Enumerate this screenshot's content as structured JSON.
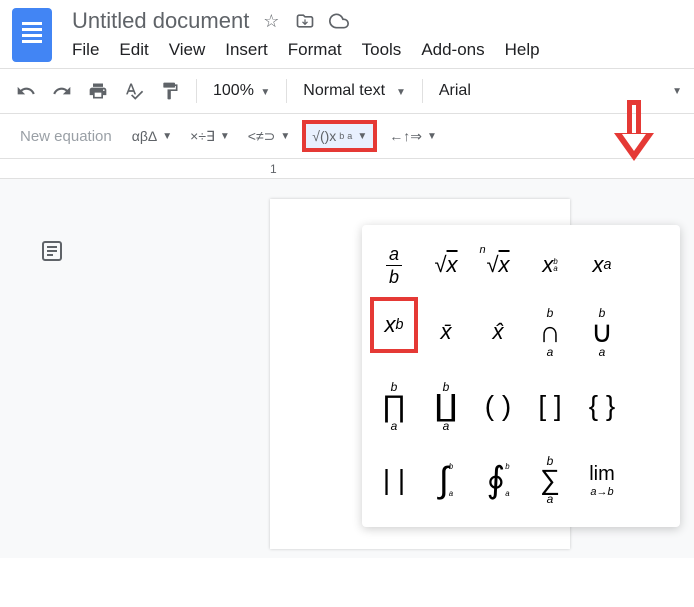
{
  "doc": {
    "title": "Untitled document"
  },
  "menu": {
    "file": "File",
    "edit": "Edit",
    "view": "View",
    "insert": "Insert",
    "format": "Format",
    "tools": "Tools",
    "addons": "Add-ons",
    "help": "Help"
  },
  "toolbar": {
    "zoom": "100%",
    "style": "Normal text",
    "font": "Arial"
  },
  "equation": {
    "new_label": "New equation",
    "greek": "αβΔ",
    "ops": "×÷∃",
    "rels": "<≠⊃",
    "math": "√()x",
    "arrows": "←↑⇒"
  },
  "ruler": {
    "mark": "1"
  },
  "submenu": {
    "frac_a": "a",
    "frac_b": "b",
    "sqrt": "√x",
    "nroot_n": "n",
    "nroot_x": "√x",
    "xab_base": "x",
    "xab_a": "a",
    "xab_b": "b",
    "xsub_base": "x",
    "xsub_a": "a",
    "xsup_base": "x",
    "xsup_b": "b",
    "xbar": "x̄",
    "xhat": "x̂",
    "cap": "∩",
    "cap_a": "a",
    "cap_b": "b",
    "cup": "∪",
    "cup_a": "a",
    "cup_b": "b",
    "prod": "∏",
    "prod_a": "a",
    "prod_b": "b",
    "coprod": "∐",
    "coprod_a": "a",
    "coprod_b": "b",
    "paren": "( )",
    "bracket": "[ ]",
    "brace": "{ }",
    "bars": "| |",
    "int": "∫",
    "int_a": "a",
    "int_b": "b",
    "oint": "∮",
    "oint_a": "a",
    "oint_b": "b",
    "sum": "∑",
    "sum_a": "a",
    "sum_b": "b",
    "lim": "lim",
    "lim_sub": "a→b"
  }
}
